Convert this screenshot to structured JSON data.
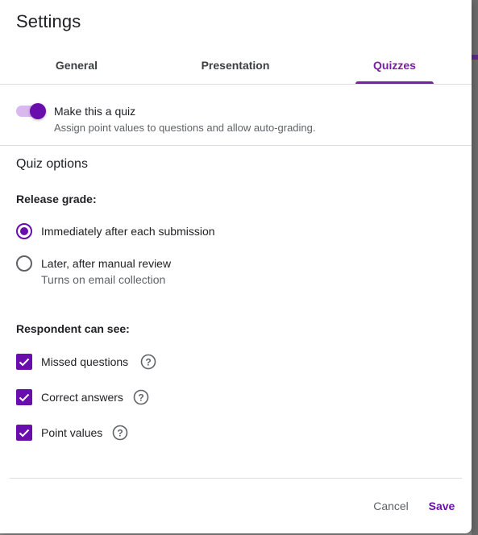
{
  "dialog": {
    "title": "Settings"
  },
  "tabs": [
    {
      "label": "General",
      "active": false
    },
    {
      "label": "Presentation",
      "active": false
    },
    {
      "label": "Quizzes",
      "active": true
    }
  ],
  "quiz_toggle": {
    "label": "Make this a quiz",
    "description": "Assign point values to questions and allow auto-grading.",
    "on": true
  },
  "quiz_options": {
    "title": "Quiz options",
    "release_grade": {
      "heading": "Release grade:",
      "options": [
        {
          "label": "Immediately after each submission",
          "checked": true
        },
        {
          "label": "Later, after manual review",
          "description": "Turns on email collection",
          "checked": false
        }
      ]
    },
    "respondent": {
      "heading": "Respondent can see:",
      "items": [
        {
          "label": "Missed questions",
          "checked": true,
          "icon": "help-icon"
        },
        {
          "label": "Correct answers",
          "checked": true,
          "icon": "help-icon"
        },
        {
          "label": "Point values",
          "checked": true,
          "icon": "help-icon"
        }
      ]
    }
  },
  "footer": {
    "cancel_label": "Cancel",
    "save_label": "Save"
  },
  "colors": {
    "accent": "#6a0dad",
    "tab_active": "#7b1fa2",
    "text": "#202124",
    "secondary_text": "#5f6368",
    "divider": "#dadce0"
  }
}
